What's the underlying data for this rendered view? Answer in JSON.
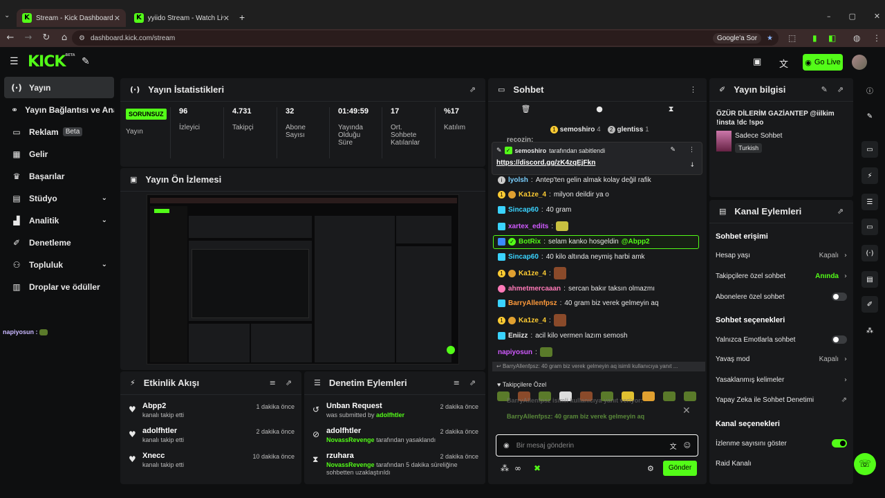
{
  "browser": {
    "tabs": [
      {
        "title": "Stream - Kick Dashboard",
        "favicon": "K"
      },
      {
        "title": "yyiido Stream - Watch Live on K",
        "favicon": "K"
      }
    ],
    "url": "dashboard.kick.com/stream",
    "google_pill": "Google'a Sor"
  },
  "header": {
    "logo": "KICK",
    "logo_beta": "BETA",
    "go_live": "Go Live"
  },
  "sidebar": {
    "items": [
      {
        "label": "Yayın",
        "icon": "broadcast-icon"
      },
      {
        "label": "Yayın Bağlantısı ve Anahtarı",
        "icon": "link-icon"
      },
      {
        "label": "Reklam",
        "icon": "ad-icon",
        "badge": "Beta"
      },
      {
        "label": "Gelir",
        "icon": "revenue-icon"
      },
      {
        "label": "Başarılar",
        "icon": "trophy-icon"
      },
      {
        "label": "Stüdyo",
        "icon": "studio-icon"
      },
      {
        "label": "Analitik",
        "icon": "analytics-icon"
      },
      {
        "label": "Denetleme",
        "icon": "wrench-icon"
      },
      {
        "label": "Topluluk",
        "icon": "community-icon"
      },
      {
        "label": "Droplar ve ödüller",
        "icon": "gift-icon"
      }
    ],
    "floating_user": "napiyosun :"
  },
  "stats": {
    "title": "Yayın İstatistikleri",
    "status": "SORUNSUZ",
    "status_label": "Yayın",
    "items": [
      {
        "value": "96",
        "label": "İzleyici"
      },
      {
        "value": "4.731",
        "label": "Takipçi"
      },
      {
        "value": "32",
        "label": "Abone Sayısı"
      },
      {
        "value": "01:49:59",
        "label": "Yayında Olduğu Süre"
      },
      {
        "value": "17",
        "label": "Ort. Sohbete Katılanlar"
      },
      {
        "value": "%17",
        "label": "Katılım"
      }
    ]
  },
  "preview": {
    "title": "Yayın Ön İzlemesi"
  },
  "activity": {
    "title": "Etkinlik Akışı",
    "items": [
      {
        "name": "Abpp2",
        "desc": "kanalı takip etti",
        "time": "1 dakika önce"
      },
      {
        "name": "adolfhtler",
        "desc": "kanalı takip etti",
        "time": "2 dakika önce"
      },
      {
        "name": "Xnecc",
        "desc": "kanalı takip etti",
        "time": "10 dakika önce"
      }
    ]
  },
  "moderation": {
    "title": "Denetim Eylemleri",
    "items": [
      {
        "name": "Unban Request",
        "desc_prefix": "was submitted by",
        "actor": "adolfhtler",
        "desc_suffix": "",
        "time": "2 dakika önce"
      },
      {
        "name": "adolfhtler",
        "desc_prefix": "",
        "actor": "NovassRevenge",
        "desc_suffix": "tarafından yasaklandı",
        "time": "2 dakika önce"
      },
      {
        "name": "rzuhara",
        "desc_prefix": "",
        "actor": "NovassRevenge",
        "desc_suffix": "tarafından 5 dakika süreliğine sohbetten uzaklaştırıldı",
        "time": "2 dakika önce"
      }
    ]
  },
  "chat": {
    "title": "Sohbet",
    "top_users": [
      {
        "name": "semoshiro",
        "count": "4"
      },
      {
        "name": "glentiss",
        "count": "1"
      }
    ],
    "scrolled_user": "recozin:",
    "pinned_by": "semoshiro",
    "pinned_suffix": "tarafından sabitlendi",
    "pinned_link": "https://discord.gg/zK4zqEjFkn",
    "messages": [
      {
        "user": "lyolsh",
        "color": "#7ad0ff",
        "text": "Antep'ten gelin almak kolay değil rafik"
      },
      {
        "user": "Ka1ze_4",
        "color": "#ffcc33",
        "text": "milyon deildir ya o"
      },
      {
        "user": "Sincap60",
        "color": "#3ad3ff",
        "text": "40 gram"
      },
      {
        "user": "xartex_edits",
        "color": "#d05aff",
        "text": ""
      },
      {
        "user": "BotRix",
        "color": "#53fc18",
        "text": "selam kanko hosgeldin",
        "mention": "@Abpp2"
      },
      {
        "user": "Sincap60",
        "color": "#3ad3ff",
        "text": "40 kilo altında neymiş harbi amk"
      },
      {
        "user": "Ka1ze_4",
        "color": "#ffcc33",
        "text": ""
      },
      {
        "user": "ahmetmercaaan",
        "color": "#ff7ab8",
        "text": "sercan bakır taksın olmazmı"
      },
      {
        "user": "BarryAllenfpsz",
        "color": "#ff9a3a",
        "text": "40 gram biz verek gelmeyin aq"
      },
      {
        "user": "Ka1ze_4",
        "color": "#ffcc33",
        "text": ""
      },
      {
        "user": "Eniizz",
        "color": "#e8e8e8",
        "text": "acil kilo vermen lazım semosh"
      },
      {
        "user": "napiyosun",
        "color": "#d05aff",
        "text": ""
      }
    ],
    "reply_preview": "BarryAllenfpsz: 40 gram biz verek gelmeyin aq isimli kullanıcıya yanıt ...",
    "followers_only": "Takipçilere Özel",
    "reply_banner": "BarryAllenfpsz isimli kullanıcıya yanıt veriyor:",
    "reply_quote": "BarryAllenfpsz: 40 gram biz verek gelmeyin aq",
    "input_placeholder": "Bir mesaj gönderin",
    "send": "Gönder"
  },
  "stream_info": {
    "title": "Yayın bilgisi",
    "stream_title": "ÖZÜR DİLERİM GAZİANTEP @iilkim !insta !dc !spo",
    "category": "Sadece Sohbet",
    "tag": "Turkish"
  },
  "channel_actions": {
    "title": "Kanal Eylemleri",
    "chat_access": "Sohbet erişimi",
    "account_age": {
      "label": "Hesap yaşı",
      "value": "Kapalı"
    },
    "followers_chat": {
      "label": "Takipçilere özel sohbet",
      "value": "Anında"
    },
    "subs_chat": {
      "label": "Abonelere özel sohbet"
    },
    "chat_options": "Sohbet seçenekleri",
    "emote_only": {
      "label": "Yalnızca Emotlarla sohbet"
    },
    "slow_mode": {
      "label": "Yavaş mod",
      "value": "Kapalı"
    },
    "banned_words": {
      "label": "Yasaklanmış kelimeler"
    },
    "ai_mod": {
      "label": "Yapay Zeka ile Sohbet Denetimi"
    },
    "channel_options": "Kanal seçenekleri",
    "show_viewers": {
      "label": "İzlenme sayısını göster"
    },
    "raid": {
      "label": "Raid Kanalı"
    }
  },
  "colors": {
    "accent": "#53fc18",
    "panel": "#18191b",
    "bg": "#0e0f10"
  }
}
